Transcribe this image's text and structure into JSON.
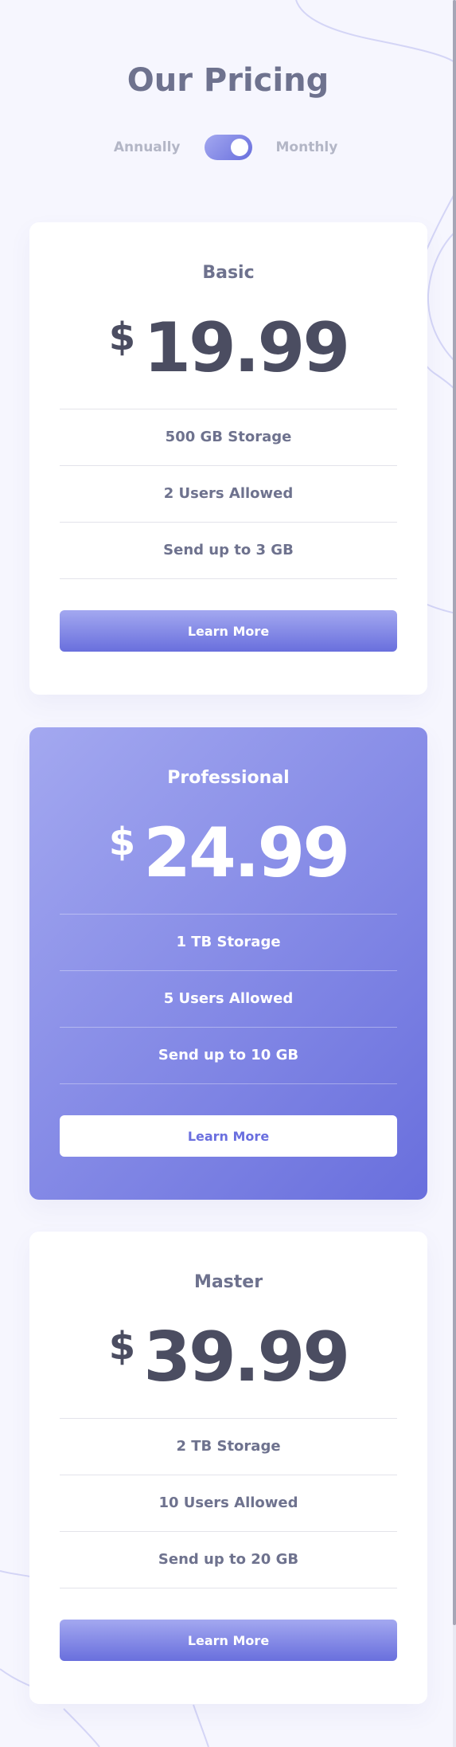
{
  "page": {
    "title": "Our Pricing"
  },
  "billing_toggle": {
    "left_label": "Annually",
    "right_label": "Monthly",
    "selected": "Monthly"
  },
  "colors": {
    "background": "#f6f6fe",
    "accent_start": "#a3a8f0",
    "accent_end": "#696fdd",
    "heading_text": "#6e728e",
    "price_text": "#4b4d61",
    "muted_text": "#b3b6c6"
  },
  "plans": [
    {
      "name": "Basic",
      "currency": "$",
      "price": "19.99",
      "featured": false,
      "features": [
        "500 GB Storage",
        "2 Users Allowed",
        "Send up to 3 GB"
      ],
      "cta_label": "Learn More"
    },
    {
      "name": "Professional",
      "currency": "$",
      "price": "24.99",
      "featured": true,
      "features": [
        "1 TB Storage",
        "5 Users Allowed",
        "Send up to 10 GB"
      ],
      "cta_label": "Learn More"
    },
    {
      "name": "Master",
      "currency": "$",
      "price": "39.99",
      "featured": false,
      "features": [
        "2 TB Storage",
        "10 Users Allowed",
        "Send up to 20 GB"
      ],
      "cta_label": "Learn More"
    }
  ]
}
